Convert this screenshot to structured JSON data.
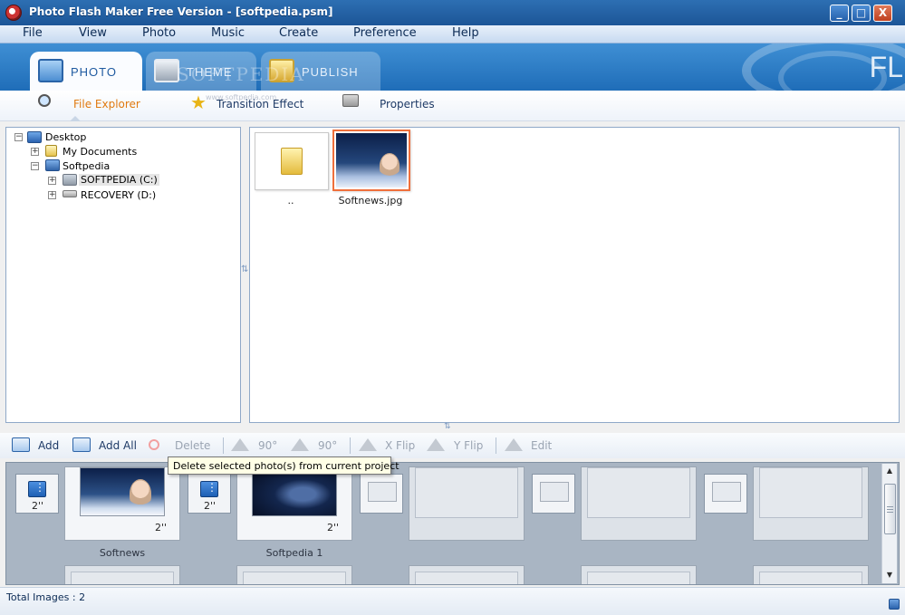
{
  "window": {
    "title": "Photo Flash Maker Free Version - [softpedia.psm]",
    "minimize": "_",
    "maximize": "□",
    "close": "X"
  },
  "menu": [
    "File",
    "View",
    "Photo",
    "Music",
    "Create",
    "Preference",
    "Help"
  ],
  "tabs": [
    {
      "label": "PHOTO",
      "active": true,
      "icon": "photo-tab-icon"
    },
    {
      "label": "THEME",
      "active": false,
      "icon": "theme-tab-icon"
    },
    {
      "label": "PUBLISH",
      "active": false,
      "icon": "publish-tab-icon"
    }
  ],
  "brand_text": "FL",
  "watermark": {
    "text": "SOFTPEDIA",
    "url": "www.softpedia.com"
  },
  "subtabs": [
    {
      "label": "File Explorer",
      "active": true,
      "icon": "magnifier-icon"
    },
    {
      "label": "Transition Effect",
      "active": false,
      "icon": "star-icon"
    },
    {
      "label": "Properties",
      "active": false,
      "icon": "printer-icon"
    }
  ],
  "tree": {
    "items": [
      {
        "label": "Desktop",
        "expander": "−"
      },
      {
        "label": "My Documents",
        "expander": "+"
      },
      {
        "label": "Softpedia",
        "expander": "−"
      },
      {
        "label": "SOFTPEDIA (C:)",
        "expander": "+"
      },
      {
        "label": "RECOVERY (D:)",
        "expander": "+"
      }
    ]
  },
  "files": [
    {
      "label": "..",
      "type": "folder"
    },
    {
      "label": "Softnews.jpg",
      "type": "image",
      "selected": true
    }
  ],
  "storyboard_toolbar": {
    "add": "Add",
    "add_all": "Add All",
    "delete": "Delete",
    "rotate_left": "90°",
    "rotate_right": "90°",
    "x_flip": "X Flip",
    "y_flip": "Y Flip",
    "edit": "Edit"
  },
  "tooltip": "Delete selected photo(s) from current project",
  "storyboard": {
    "transitions": [
      {
        "duration": "2''"
      },
      {
        "duration": "2''"
      }
    ],
    "slides": [
      {
        "name": "Softnews",
        "duration": "2''"
      },
      {
        "name": "Softpedia 1",
        "duration": "2''"
      }
    ]
  },
  "status": "Total Images : 2",
  "colors": {
    "accent": "#e07a10",
    "selection_border": "#ef6f3b",
    "title_bar": "#1c5597"
  }
}
